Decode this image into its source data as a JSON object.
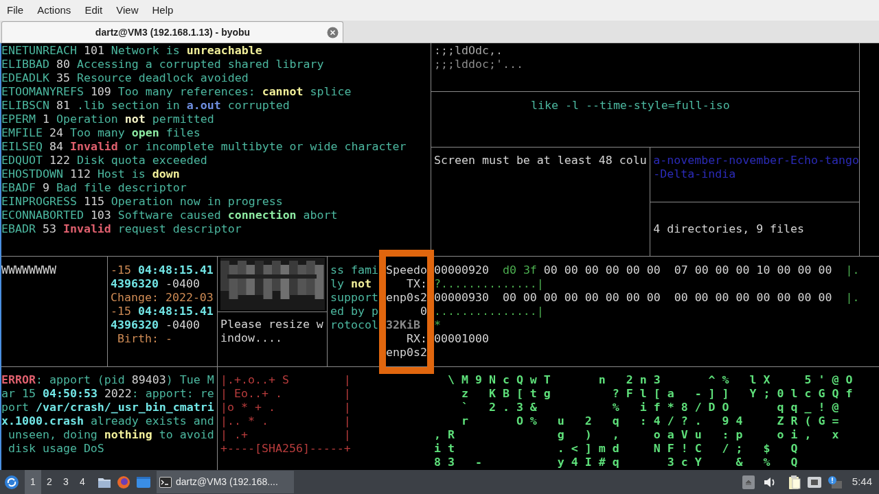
{
  "menu_bar": [
    "File",
    "Actions",
    "Edit",
    "View",
    "Help"
  ],
  "tabs": [
    {
      "label": "dartz@VM3 (192.168.1.13) - byobu",
      "selected": true
    }
  ],
  "terminal": {
    "errno": [
      [
        {
          "text": "ENETUNREACH",
          "kind": "text",
          "bold": false
        },
        {
          "text": " 101 ",
          "kind": "plain",
          "bold": false
        },
        {
          "text": "Network is ",
          "kind": "text",
          "bold": false
        },
        {
          "text": "unreachable",
          "kind": "warn",
          "bold": true
        }
      ],
      [
        {
          "text": "ELIBBAD",
          "kind": "text",
          "bold": false
        },
        {
          "text": " 80 ",
          "kind": "plain",
          "bold": false
        },
        {
          "text": "Accessing a corrupted shared library",
          "kind": "text",
          "bold": false
        }
      ],
      [
        {
          "text": "EDEADLK",
          "kind": "text",
          "bold": false
        },
        {
          "text": " 35 ",
          "kind": "plain",
          "bold": false
        },
        {
          "text": "Resource deadlock avoided",
          "kind": "text",
          "bold": false
        }
      ],
      [
        {
          "text": "ETOOMANYREFS",
          "kind": "text",
          "bold": false
        },
        {
          "text": " 109 ",
          "kind": "plain",
          "bold": false
        },
        {
          "text": "Too many references: ",
          "kind": "text",
          "bold": false
        },
        {
          "text": "cannot",
          "kind": "warn",
          "bold": true
        },
        {
          "text": " splice",
          "kind": "text",
          "bold": false
        }
      ],
      [
        {
          "text": "ELIBSCN",
          "kind": "text",
          "bold": false
        },
        {
          "text": " 81 ",
          "kind": "plain",
          "bold": false
        },
        {
          "text": ".lib section in ",
          "kind": "text",
          "bold": false
        },
        {
          "text": "a.out",
          "kind": "file",
          "bold": true
        },
        {
          "text": " corrupted",
          "kind": "text",
          "bold": false
        }
      ],
      [
        {
          "text": "EPERM",
          "kind": "text",
          "bold": false
        },
        {
          "text": " 1 ",
          "kind": "plain",
          "bold": false
        },
        {
          "text": "Operation ",
          "kind": "text",
          "bold": false
        },
        {
          "text": "not",
          "kind": "emph",
          "bold": true
        },
        {
          "text": " permitted",
          "kind": "text",
          "bold": false
        }
      ],
      [
        {
          "text": "EMFILE",
          "kind": "text",
          "bold": false
        },
        {
          "text": " 24 ",
          "kind": "plain",
          "bold": false
        },
        {
          "text": "Too many ",
          "kind": "text",
          "bold": false
        },
        {
          "text": "open",
          "kind": "good",
          "bold": true
        },
        {
          "text": " files",
          "kind": "text",
          "bold": false
        }
      ],
      [
        {
          "text": "EILSEQ",
          "kind": "text",
          "bold": false
        },
        {
          "text": " 84 ",
          "kind": "plain",
          "bold": false
        },
        {
          "text": "Invalid",
          "kind": "error",
          "bold": true
        },
        {
          "text": " or incomplete multibyte or wide character",
          "kind": "text",
          "bold": false
        }
      ],
      [
        {
          "text": "EDQUOT",
          "kind": "text",
          "bold": false
        },
        {
          "text": " 122 ",
          "kind": "plain",
          "bold": false
        },
        {
          "text": "Disk quota exceeded",
          "kind": "text",
          "bold": false
        }
      ],
      [
        {
          "text": "EHOSTDOWN",
          "kind": "text",
          "bold": false
        },
        {
          "text": " 112 ",
          "kind": "plain",
          "bold": false
        },
        {
          "text": "Host is ",
          "kind": "text",
          "bold": false
        },
        {
          "text": "down",
          "kind": "warn",
          "bold": true
        }
      ],
      [
        {
          "text": "EBADF",
          "kind": "text",
          "bold": false
        },
        {
          "text": " 9 ",
          "kind": "plain",
          "bold": false
        },
        {
          "text": "Bad file descriptor",
          "kind": "text",
          "bold": false
        }
      ],
      [
        {
          "text": "EINPROGRESS",
          "kind": "text",
          "bold": false
        },
        {
          "text": " 115 ",
          "kind": "plain",
          "bold": false
        },
        {
          "text": "Operation now in progress",
          "kind": "text",
          "bold": false
        }
      ],
      [
        {
          "text": "ECONNABORTED",
          "kind": "text",
          "bold": false
        },
        {
          "text": " 103 ",
          "kind": "plain",
          "bold": false
        },
        {
          "text": "Software caused ",
          "kind": "text",
          "bold": false
        },
        {
          "text": "connection",
          "kind": "good",
          "bold": true
        },
        {
          "text": " abort",
          "kind": "text",
          "bold": false
        }
      ],
      [
        {
          "text": "EBADR",
          "kind": "text",
          "bold": false
        },
        {
          "text": " 53 ",
          "kind": "plain",
          "bold": false
        },
        {
          "text": "Invalid",
          "kind": "error",
          "bold": true
        },
        {
          "text": " request descriptor",
          "kind": "text",
          "bold": false
        }
      ]
    ],
    "art": [
      [
        {
          "text": ":;;ldOdc,.",
          "kind": "art",
          "bold": false
        }
      ],
      [
        {
          "text": ";;;lddoc;'...",
          "kind": "faint",
          "bold": false
        }
      ]
    ],
    "ls_hint": [
      [
        {
          "text": "like -l --time-style=full-iso",
          "kind": "text",
          "bold": false
        }
      ]
    ],
    "size_warning": [
      [
        {
          "text": "Screen must be at least 48 colu",
          "kind": "plain",
          "bold": false
        }
      ]
    ],
    "name_tail": [
      [
        {
          "text": "a-november-november-Echo-tango",
          "kind": "deep",
          "bold": false
        }
      ],
      [
        {
          "text": "-Delta-india",
          "kind": "deep",
          "bold": false
        }
      ]
    ],
    "tree_summary": [
      [
        {
          "text": "4 directories, 9 files",
          "kind": "plain",
          "bold": false
        }
      ]
    ],
    "filler": [
      [
        {
          "text": "WWWWWWWW",
          "kind": "plain",
          "bold": false
        }
      ]
    ],
    "stat": [
      [
        {
          "text": "-15 ",
          "kind": "label",
          "bold": false
        },
        {
          "text": "04:48:15.41",
          "kind": "stamp",
          "bold": true
        }
      ],
      [
        {
          "text": "4396320",
          "kind": "stamp",
          "bold": true
        },
        {
          "text": " -0400",
          "kind": "plain",
          "bold": false
        }
      ],
      [
        {
          "text": "Change: 2022-03",
          "kind": "label",
          "bold": false
        }
      ],
      [
        {
          "text": "-15 ",
          "kind": "label",
          "bold": false
        },
        {
          "text": "04:48:15.41",
          "kind": "stamp",
          "bold": true
        }
      ],
      [
        {
          "text": "4396320",
          "kind": "stamp",
          "bold": true
        },
        {
          "text": " -0400",
          "kind": "plain",
          "bold": false
        }
      ],
      [
        {
          "text": " Birth: -",
          "kind": "label",
          "bold": false
        }
      ]
    ],
    "image_pane": {
      "kind": "picture"
    },
    "resize_notice": [
      [
        {
          "text": "Please resize w",
          "kind": "plain",
          "bold": false
        }
      ],
      [
        {
          "text": "indow....",
          "kind": "plain",
          "bold": false
        }
      ]
    ],
    "protocol": [
      [
        {
          "text": "ss fami",
          "kind": "text",
          "bold": false
        }
      ],
      [
        {
          "text": "ly ",
          "kind": "text",
          "bold": false
        },
        {
          "text": "not",
          "kind": "warn",
          "bold": true
        }
      ],
      [
        {
          "text": "support",
          "kind": "text",
          "bold": false
        }
      ],
      [
        {
          "text": "ed by p",
          "kind": "text",
          "bold": false
        }
      ],
      [
        {
          "text": "rotocol",
          "kind": "text",
          "bold": false
        }
      ]
    ],
    "speedometer": [
      [
        {
          "text": "Speedo",
          "kind": "plain",
          "bold": false
        }
      ],
      [
        {
          "text": "   TX:",
          "kind": "plain",
          "bold": false
        }
      ],
      [
        {
          "text": "enp0s2",
          "kind": "plain",
          "bold": false
        }
      ],
      [
        {
          "text": "     0",
          "kind": "plain",
          "bold": false
        }
      ],
      [
        {
          "text": "32KiB",
          "kind": "dim",
          "bold": true
        }
      ],
      [
        {
          "text": "   RX:",
          "kind": "plain",
          "bold": false
        }
      ],
      [
        {
          "text": "enp0s2",
          "kind": "plain",
          "bold": false
        }
      ]
    ],
    "hexdump": [
      [
        {
          "text": "00000920  ",
          "kind": "plain",
          "bold": false
        },
        {
          "text": "d0 3f",
          "kind": "ascii",
          "bold": false
        },
        {
          "text": " 00 00 00 00 00 00  07 00 00 00 10 00 00 00  ",
          "kind": "plain",
          "bold": false
        },
        {
          "text": "|.",
          "kind": "ascii",
          "bold": false
        }
      ],
      [
        {
          "text": "?..............|",
          "kind": "ascii",
          "bold": false
        }
      ],
      [
        {
          "text": "00000930  00 00 00 00 00 00 00 00  00 00 00 00 00 00 00 00  ",
          "kind": "plain",
          "bold": false
        },
        {
          "text": "|.",
          "kind": "ascii",
          "bold": false
        }
      ],
      [
        {
          "text": "...............|",
          "kind": "ascii",
          "bold": false
        }
      ],
      [
        {
          "text": "*",
          "kind": "ascii",
          "bold": false
        }
      ],
      [
        {
          "text": "00001000",
          "kind": "plain",
          "bold": false
        }
      ]
    ],
    "crash_report": [
      [
        {
          "text": "ERROR",
          "kind": "error",
          "bold": true
        },
        {
          "text": ": apport (pid ",
          "kind": "text",
          "bold": false
        },
        {
          "text": "89403",
          "kind": "plain",
          "bold": false
        },
        {
          "text": ") Tue M",
          "kind": "text",
          "bold": false
        }
      ],
      [
        {
          "text": "ar 15 ",
          "kind": "text",
          "bold": false
        },
        {
          "text": "04:50:53",
          "kind": "stamp",
          "bold": true
        },
        {
          "text": " 2022",
          "kind": "plain",
          "bold": false
        },
        {
          "text": ": apport: re",
          "kind": "text",
          "bold": false
        }
      ],
      [
        {
          "text": "port ",
          "kind": "text",
          "bold": false
        },
        {
          "text": "/var/crash/_usr_bin_cmatri",
          "kind": "stamp",
          "bold": true
        }
      ],
      [
        {
          "text": "x.1000.crash",
          "kind": "stamp",
          "bold": true
        },
        {
          "text": " already exists and",
          "kind": "text",
          "bold": false
        }
      ],
      [
        {
          "text": " unseen, doing ",
          "kind": "text",
          "bold": false
        },
        {
          "text": "nothing",
          "kind": "warn",
          "bold": true
        },
        {
          "text": " to avoid",
          "kind": "text",
          "bold": false
        }
      ],
      [
        {
          "text": " disk usage DoS",
          "kind": "text",
          "bold": false
        }
      ]
    ],
    "randomart": [
      [
        {
          "text": "|.+.o..+ S        |",
          "kind": "frame",
          "bold": false
        }
      ],
      [
        {
          "text": "| Eo..+ .         |",
          "kind": "frame",
          "bold": false
        }
      ],
      [
        {
          "text": "|o * + .          |",
          "kind": "frame",
          "bold": false
        }
      ],
      [
        {
          "text": "|.. * .           |",
          "kind": "frame",
          "bold": false
        }
      ],
      [
        {
          "text": "| .+              |",
          "kind": "frame",
          "bold": false
        }
      ],
      [
        {
          "text": "+----[SHA256]-----+",
          "kind": "frame",
          "bold": false
        }
      ]
    ],
    "matrix": [
      [
        {
          "text": "  \\ M 9 N c Q w T       n   2 n 3       ^ %   l X     5 ' @ O",
          "kind": "rain",
          "bold": true
        }
      ],
      [
        {
          "text": "    z   K B [ t g         ? F l [ a   - ] ]   Y ; 0 l c G Q f",
          "kind": "rain",
          "bold": true
        }
      ],
      [
        {
          "text": "    `   2 . 3 &           %   i f * 8 / D O       q q _ ! @",
          "kind": "rain",
          "bold": true
        }
      ],
      [
        {
          "text": "    r       O %   u   2   q   : 4 / ? .   9 4     Z R ( G =",
          "kind": "rain",
          "bold": true
        }
      ],
      [
        {
          "text": ", R               g   )   ,     o a V u   : p     o i ,   x",
          "kind": "rain",
          "bold": true
        }
      ],
      [
        {
          "text": "i t               . < ] m d     N F ! C   / ;   $   Q",
          "kind": "rain",
          "bold": true
        }
      ],
      [
        {
          "text": "8 3   -           y 4 I # q       3 c Y     &   %   Q",
          "kind": "rain",
          "bold": true
        }
      ]
    ]
  },
  "taskbar": {
    "workspaces": [
      {
        "label": "1",
        "selected": true
      },
      {
        "label": "2",
        "selected": false
      },
      {
        "label": "3",
        "selected": false
      },
      {
        "label": "4",
        "selected": false
      }
    ],
    "tasks": [
      {
        "label": "dartz@VM3 (192.168....",
        "selected": true
      }
    ],
    "clock": "5:44"
  }
}
